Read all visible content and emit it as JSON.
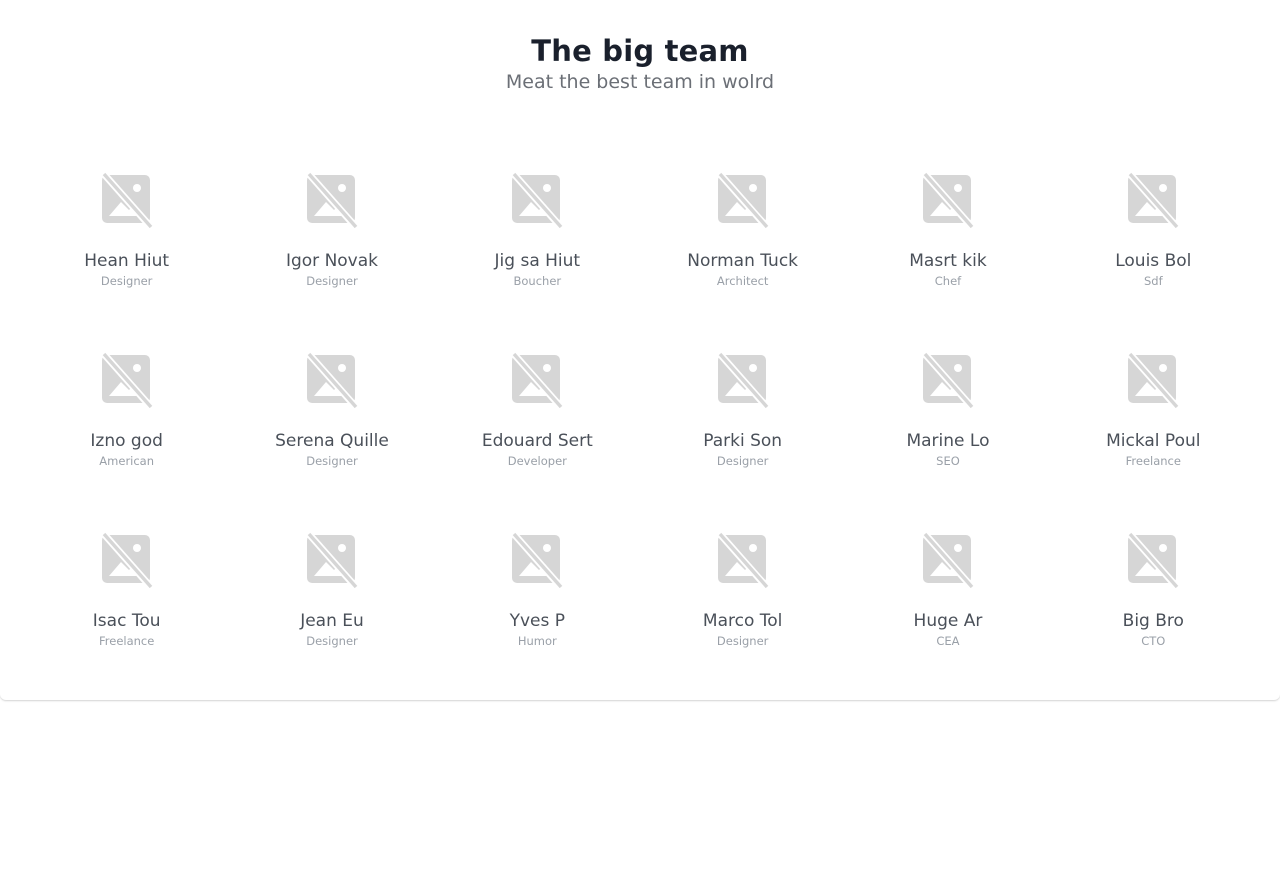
{
  "header": {
    "title": "The big team",
    "subtitle": "Meat the best team in wolrd"
  },
  "colors": {
    "title": "#1a202c",
    "subtitle": "#6b6f76",
    "name": "#4a5059",
    "role": "#9aa0a8",
    "placeholder_icon": "#d6d6d6"
  },
  "members": [
    {
      "name": "Hean Hiut",
      "role": "Designer",
      "icon": "broken-image-icon"
    },
    {
      "name": "Igor Novak",
      "role": "Designer",
      "icon": "broken-image-icon"
    },
    {
      "name": "Jig sa Hiut",
      "role": "Boucher",
      "icon": "broken-image-icon"
    },
    {
      "name": "Norman Tuck",
      "role": "Architect",
      "icon": "broken-image-icon"
    },
    {
      "name": "Masrt kik",
      "role": "Chef",
      "icon": "broken-image-icon"
    },
    {
      "name": "Louis Bol",
      "role": "Sdf",
      "icon": "broken-image-icon"
    },
    {
      "name": "Izno god",
      "role": "American",
      "icon": "broken-image-icon"
    },
    {
      "name": "Serena Quille",
      "role": "Designer",
      "icon": "broken-image-icon"
    },
    {
      "name": "Edouard Sert",
      "role": "Developer",
      "icon": "broken-image-icon"
    },
    {
      "name": "Parki Son",
      "role": "Designer",
      "icon": "broken-image-icon"
    },
    {
      "name": "Marine Lo",
      "role": "SEO",
      "icon": "broken-image-icon"
    },
    {
      "name": "Mickal Poul",
      "role": "Freelance",
      "icon": "broken-image-icon"
    },
    {
      "name": "Isac Tou",
      "role": "Freelance",
      "icon": "broken-image-icon"
    },
    {
      "name": "Jean Eu",
      "role": "Designer",
      "icon": "broken-image-icon"
    },
    {
      "name": "Yves P",
      "role": "Humor",
      "icon": "broken-image-icon"
    },
    {
      "name": "Marco Tol",
      "role": "Designer",
      "icon": "broken-image-icon"
    },
    {
      "name": "Huge Ar",
      "role": "CEA",
      "icon": "broken-image-icon"
    },
    {
      "name": "Big Bro",
      "role": "CTO",
      "icon": "broken-image-icon"
    }
  ]
}
